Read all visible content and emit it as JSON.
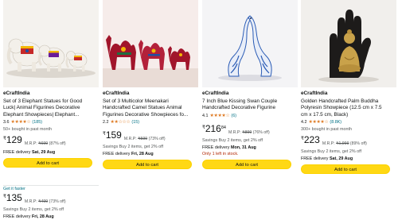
{
  "products": [
    {
      "brand": "eCraftIndia",
      "title_l1": "Set of 3 Elephant Statues for Good",
      "title_l2": "Luck| Animal Figurines Decorative",
      "title_l3": "Elephant Showpieces| Elephant...",
      "rating": "3.6",
      "stars": "★★★★☆",
      "rating_count": "(185)",
      "bought": "50+ bought in past month",
      "price": "129",
      "currency": "₹",
      "mrp_label": "M.R.P:",
      "mrp": "₹699",
      "discount": "(87% off)",
      "delivery_prefix": "FREE delivery",
      "delivery_date": "Sat, 29 Aug",
      "button": "Add to cart"
    },
    {
      "brand": "eCraftIndia",
      "title_l1": "Set of 3 Multicolor Meenakari",
      "title_l2": "Handcrafted Camel Statues Animal",
      "title_l3": "Figurines Decorative Showpieces fo...",
      "rating": "2.2",
      "stars": "★★☆☆☆",
      "rating_count": "(15)",
      "price": "159",
      "currency": "₹",
      "mrp_label": "M.R.P:",
      "mrp": "₹599",
      "discount": "(73% off)",
      "savings": "Savings Buy 2 items, get 2% off",
      "delivery_prefix": "FREE delivery",
      "delivery_date": "Fri, 28 Aug",
      "button": "Add to cart"
    },
    {
      "brand": "eCraftIndia",
      "title_l1": "7 Inch Blue Kissing Swan Couple",
      "title_l2": "Handcrafted Decorative Figurine",
      "rating": "4.1",
      "stars": "★★★★☆",
      "rating_count": "(6)",
      "price": "216",
      "price_sup": "84",
      "currency": "₹",
      "mrp_label": "M.R.P:",
      "mrp": "₹899",
      "discount": "(76% off)",
      "savings": "Savings Buy 2 items, get 2% off",
      "delivery_prefix": "FREE delivery",
      "delivery_date": "Mon, 31 Aug",
      "stock": "Only 1 left in stock.",
      "button": "Add to cart"
    },
    {
      "brand": "eCraftIndia",
      "title_l1": "Golden Handcrafted Palm Buddha",
      "title_l2": "Polyresin Showpiece (12.5 cm x 7.5",
      "title_l3": "cm x 17.5 cm, Black)",
      "rating": "4.2",
      "stars": "★★★★☆",
      "rating_count": "(8.8K)",
      "bought": "300+ bought in past month",
      "price": "223",
      "currency": "₹",
      "mrp_label": "M.R.P:",
      "mrp": "₹1,999",
      "discount": "(89% off)",
      "savings": "Savings Buy 2 items, get 2% off",
      "delivery_prefix": "FREE delivery",
      "delivery_date": "Sat, 29 Aug",
      "button": "Add to cart"
    }
  ],
  "extra_offer": {
    "label": "Get it faster",
    "price": "135",
    "currency": "₹",
    "mrp_label": "M.R.P:",
    "mrp": "₹499",
    "discount": "(73% off)",
    "savings": "Savings Buy 2 items, get 2% off",
    "delivery_prefix": "FREE delivery",
    "delivery_date": "Fri, 28 Aug"
  }
}
